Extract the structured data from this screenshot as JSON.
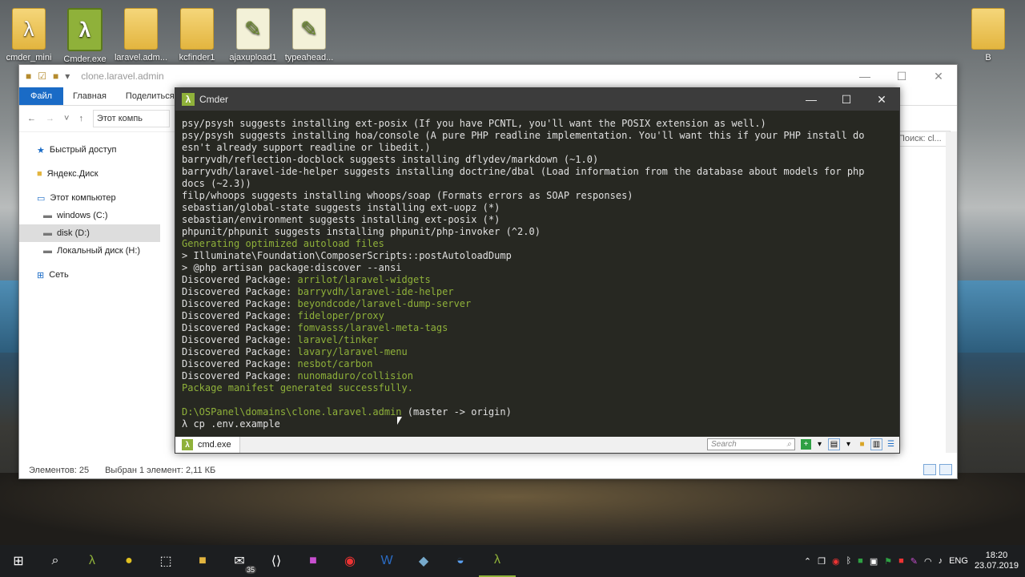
{
  "desktop": {
    "icons": [
      {
        "label": "cmder_mini",
        "icon": "cmder-folder-icon"
      },
      {
        "label": "Cmder.exe",
        "icon": "cmder-app-icon"
      },
      {
        "label": "laravel.adm...",
        "icon": "folder-icon"
      },
      {
        "label": "kcfinder1",
        "icon": "folder-icon"
      },
      {
        "label": "ajaxupload1",
        "icon": "doc-folder-icon"
      },
      {
        "label": "typeahead...",
        "icon": "doc-folder-icon"
      }
    ],
    "right_icon": {
      "label": "B",
      "icon": "folder-icon"
    }
  },
  "explorer": {
    "title": "clone.laravel.admin",
    "ribbon": {
      "file": "Файл",
      "home": "Главная",
      "share": "Поделиться"
    },
    "address": "Этот компь",
    "search": "Поиск: cl...",
    "nav": [
      {
        "label": "Быстрый доступ",
        "icon": "star-icon"
      },
      {
        "label": "Яндекс.Диск",
        "icon": "yandex-disk-icon"
      },
      {
        "label": "Этот компьютер",
        "icon": "computer-icon"
      },
      {
        "label": "windows (C:)",
        "icon": "drive-icon"
      },
      {
        "label": "disk (D:)",
        "icon": "drive-icon"
      },
      {
        "label": "Локальный диск (H:)",
        "icon": "drive-icon"
      },
      {
        "label": "Сеть",
        "icon": "network-icon"
      }
    ],
    "status_items": "Элементов: 25",
    "status_selected": "Выбран 1 элемент: 2,11 КБ"
  },
  "cmder": {
    "title": "Cmder",
    "tab_label": "cmd.exe",
    "search_placeholder": "Search",
    "console_lines": [
      {
        "t": "psy/psysh suggests installing ext-posix (If you have PCNTL, you'll want the POSIX extension as well.)",
        "c": ""
      },
      {
        "t": "psy/psysh suggests installing hoa/console (A pure PHP readline implementation. You'll want this if your PHP install do",
        "c": ""
      },
      {
        "t": "esn't already support readline or libedit.)",
        "c": ""
      },
      {
        "t": "barryvdh/reflection-docblock suggests installing dflydev/markdown (~1.0)",
        "c": ""
      },
      {
        "t": "barryvdh/laravel-ide-helper suggests installing doctrine/dbal (Load information from the database about models for php",
        "c": ""
      },
      {
        "t": "docs (~2.3))",
        "c": ""
      },
      {
        "t": "filp/whoops suggests installing whoops/soap (Formats errors as SOAP responses)",
        "c": ""
      },
      {
        "t": "sebastian/global-state suggests installing ext-uopz (*)",
        "c": ""
      },
      {
        "t": "sebastian/environment suggests installing ext-posix (*)",
        "c": ""
      },
      {
        "t": "phpunit/phpunit suggests installing phpunit/php-invoker (^2.0)",
        "c": ""
      },
      {
        "t": "Generating optimized autoload files",
        "c": "g"
      },
      {
        "t": "> Illuminate\\Foundation\\ComposerScripts::postAutoloadDump",
        "c": ""
      },
      {
        "t": "> @php artisan package:discover --ansi",
        "c": ""
      },
      {
        "p": "Discovered Package: ",
        "t": "arrilot/laravel-widgets",
        "c": "g"
      },
      {
        "p": "Discovered Package: ",
        "t": "barryvdh/laravel-ide-helper",
        "c": "g"
      },
      {
        "p": "Discovered Package: ",
        "t": "beyondcode/laravel-dump-server",
        "c": "g"
      },
      {
        "p": "Discovered Package: ",
        "t": "fideloper/proxy",
        "c": "g"
      },
      {
        "p": "Discovered Package: ",
        "t": "fomvasss/laravel-meta-tags",
        "c": "g"
      },
      {
        "p": "Discovered Package: ",
        "t": "laravel/tinker",
        "c": "g"
      },
      {
        "p": "Discovered Package: ",
        "t": "lavary/laravel-menu",
        "c": "g"
      },
      {
        "p": "Discovered Package: ",
        "t": "nesbot/carbon",
        "c": "g"
      },
      {
        "p": "Discovered Package: ",
        "t": "nunomaduro/collision",
        "c": "g"
      },
      {
        "t": "Package manifest generated successfully.",
        "c": "g"
      },
      {
        "t": "",
        "c": ""
      }
    ],
    "prompt_path": "D:\\OSPanel\\domains\\clone.laravel.admin",
    "prompt_branch": " (master -> origin)",
    "command_line": "λ cp .env.example"
  },
  "taskbar": {
    "lang": "ENG",
    "time": "18:20",
    "date": "23.07.2019",
    "mail_badge": "35"
  }
}
